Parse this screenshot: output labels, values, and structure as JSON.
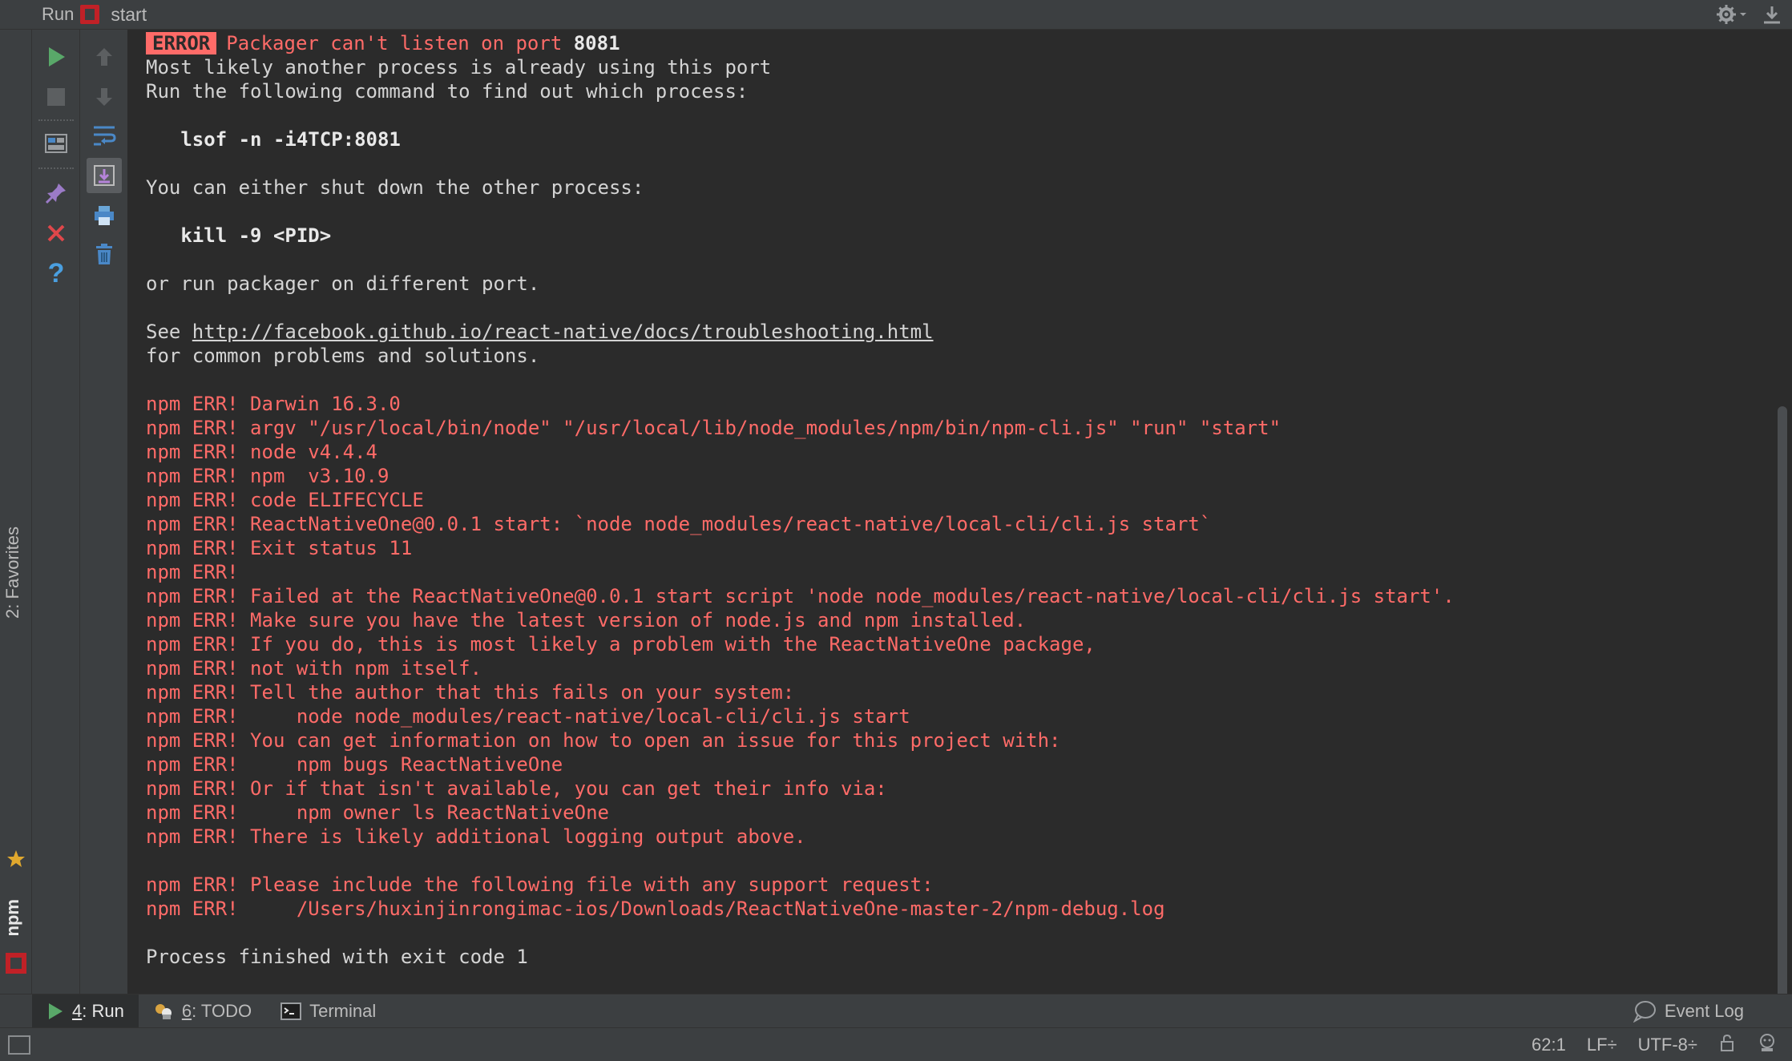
{
  "titlebar": {
    "run_label": "Run",
    "tab_name": "start"
  },
  "sidebar": {
    "favorites_label": "2: Favorites",
    "npm_label": "npm"
  },
  "console": {
    "error_tag": "ERROR",
    "error_message": "Packager can't listen on port",
    "error_port": "8081",
    "lines_before_link": [
      {
        "text": "Most likely another process is already using this port",
        "style": "normal"
      },
      {
        "text": "Run the following command to find out which process:",
        "style": "normal"
      },
      {
        "text": "",
        "style": "normal"
      },
      {
        "text": "   lsof -n -i4TCP:8081",
        "style": "bold"
      },
      {
        "text": "",
        "style": "normal"
      },
      {
        "text": "You can either shut down the other process:",
        "style": "normal"
      },
      {
        "text": "",
        "style": "normal"
      },
      {
        "text": "   kill -9 <PID>",
        "style": "bold"
      },
      {
        "text": "",
        "style": "normal"
      },
      {
        "text": "or run packager on different port.",
        "style": "normal"
      },
      {
        "text": "",
        "style": "normal"
      }
    ],
    "see_prefix": "See ",
    "troubleshooting_link": "http://facebook.github.io/react-native/docs/troubleshooting.html",
    "lines_after_link": [
      {
        "text": "for common problems and solutions.",
        "style": "normal"
      },
      {
        "text": "",
        "style": "normal"
      },
      {
        "text": "npm ERR! Darwin 16.3.0",
        "style": "red"
      },
      {
        "text": "npm ERR! argv \"/usr/local/bin/node\" \"/usr/local/lib/node_modules/npm/bin/npm-cli.js\" \"run\" \"start\"",
        "style": "red"
      },
      {
        "text": "npm ERR! node v4.4.4",
        "style": "red"
      },
      {
        "text": "npm ERR! npm  v3.10.9",
        "style": "red"
      },
      {
        "text": "npm ERR! code ELIFECYCLE",
        "style": "red"
      },
      {
        "text": "npm ERR! ReactNativeOne@0.0.1 start: `node node_modules/react-native/local-cli/cli.js start`",
        "style": "red"
      },
      {
        "text": "npm ERR! Exit status 11",
        "style": "red"
      },
      {
        "text": "npm ERR!",
        "style": "red"
      },
      {
        "text": "npm ERR! Failed at the ReactNativeOne@0.0.1 start script 'node node_modules/react-native/local-cli/cli.js start'.",
        "style": "red"
      },
      {
        "text": "npm ERR! Make sure you have the latest version of node.js and npm installed.",
        "style": "red"
      },
      {
        "text": "npm ERR! If you do, this is most likely a problem with the ReactNativeOne package,",
        "style": "red"
      },
      {
        "text": "npm ERR! not with npm itself.",
        "style": "red"
      },
      {
        "text": "npm ERR! Tell the author that this fails on your system:",
        "style": "red"
      },
      {
        "text": "npm ERR!     node node_modules/react-native/local-cli/cli.js start",
        "style": "red"
      },
      {
        "text": "npm ERR! You can get information on how to open an issue for this project with:",
        "style": "red"
      },
      {
        "text": "npm ERR!     npm bugs ReactNativeOne",
        "style": "red"
      },
      {
        "text": "npm ERR! Or if that isn't available, you can get their info via:",
        "style": "red"
      },
      {
        "text": "npm ERR!     npm owner ls ReactNativeOne",
        "style": "red"
      },
      {
        "text": "npm ERR! There is likely additional logging output above.",
        "style": "red"
      },
      {
        "text": "",
        "style": "normal"
      },
      {
        "text": "npm ERR! Please include the following file with any support request:",
        "style": "red"
      },
      {
        "text": "npm ERR!     /Users/huxinjinrongimac-ios/Downloads/ReactNativeOne-master-2/npm-debug.log",
        "style": "red"
      },
      {
        "text": "",
        "style": "normal"
      },
      {
        "text": "Process finished with exit code 1",
        "style": "normal"
      }
    ]
  },
  "bottom_tabs": {
    "run_num": "4",
    "run_label": ": Run",
    "todo_num": "6",
    "todo_label": ": TODO",
    "terminal_label": "Terminal",
    "event_log_label": "Event Log"
  },
  "status": {
    "position": "62:1",
    "line_separator": "LF÷",
    "encoding": "UTF-8÷"
  },
  "colors": {
    "error_red": "#ff6b68",
    "run_green": "#59a869",
    "background": "#2b2b2b",
    "panel": "#3c3f41"
  },
  "icons": {
    "toolbar_left": [
      "rerun-icon",
      "stop-icon",
      "layout-icon",
      "pin-icon",
      "close-icon",
      "help-icon"
    ],
    "toolbar_right": [
      "up-arrow-icon",
      "down-arrow-icon",
      "soft-wrap-icon",
      "scroll-to-end-icon",
      "print-icon",
      "trash-icon"
    ]
  }
}
